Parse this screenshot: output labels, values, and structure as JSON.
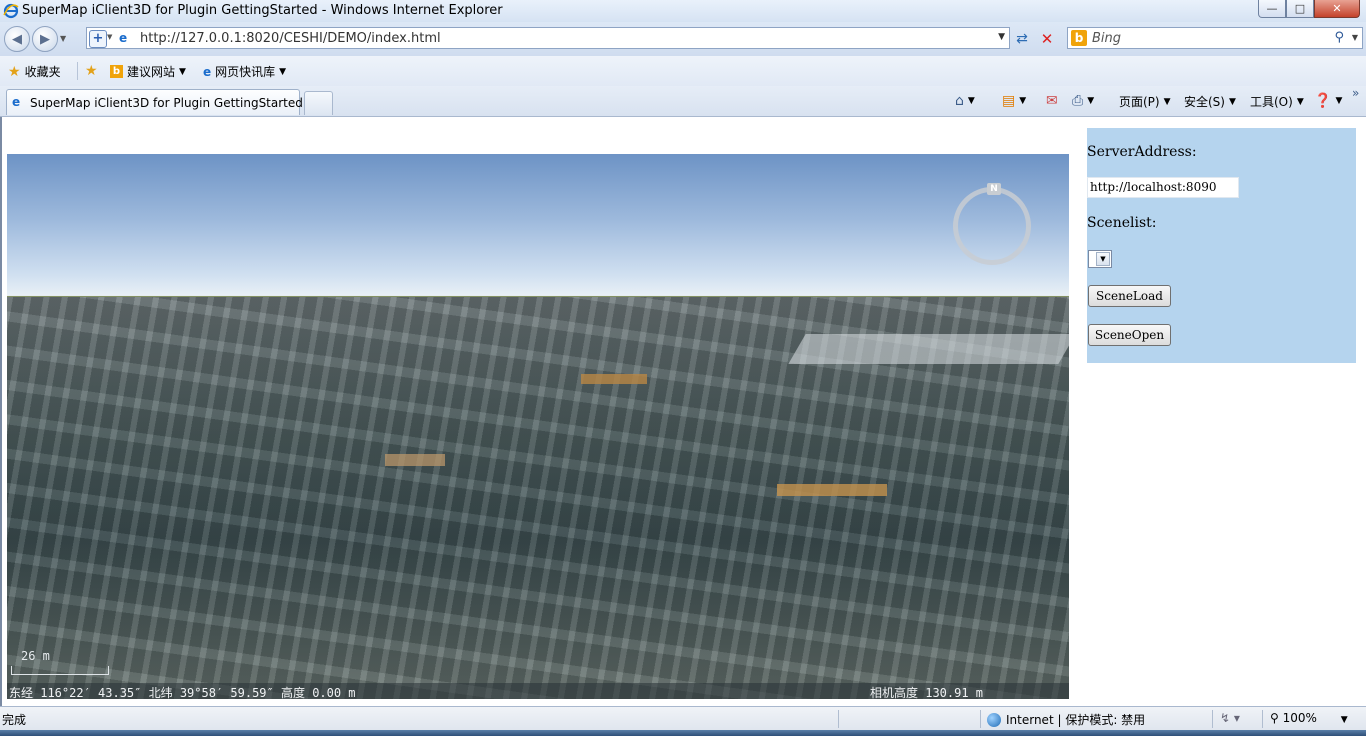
{
  "window": {
    "title": "SuperMap iClient3D for Plugin GettingStarted - Windows Internet Explorer",
    "minimize_icon": "minimize-icon",
    "maximize_icon": "maximize-icon",
    "close_icon": "close-icon"
  },
  "address": {
    "url_host": "http://127.0.0.1",
    "url_rest": ":8020/CESHI/DEMO/index.html",
    "search_placeholder": "Bing"
  },
  "favorites": {
    "favorites_label": "收藏夹",
    "suggested_sites": "建议网站",
    "web_slice_gallery": "网页快讯库"
  },
  "tabs": [
    {
      "label": "SuperMap iClient3D for Plugin GettingStarted"
    }
  ],
  "commandbar": {
    "page": "页面(P)",
    "safety": "安全(S)",
    "tools": "工具(O)"
  },
  "scene": {
    "compass_label": "N",
    "scale": "26 m",
    "coords": "东经 116°22′ 43.35″  北纬 39°58′ 59.59″  高度 0.00 m",
    "camera_height": "相机高度 130.91 m"
  },
  "panel": {
    "server_label": "ServerAddress:",
    "server_value": "http://localhost:8090",
    "scenelist_label": "Scenelist:",
    "scene_load": "SceneLoad",
    "scene_open": "SceneOpen"
  },
  "status": {
    "done": "完成",
    "zone": "Internet | 保护模式: 禁用",
    "zoom": "100%"
  }
}
